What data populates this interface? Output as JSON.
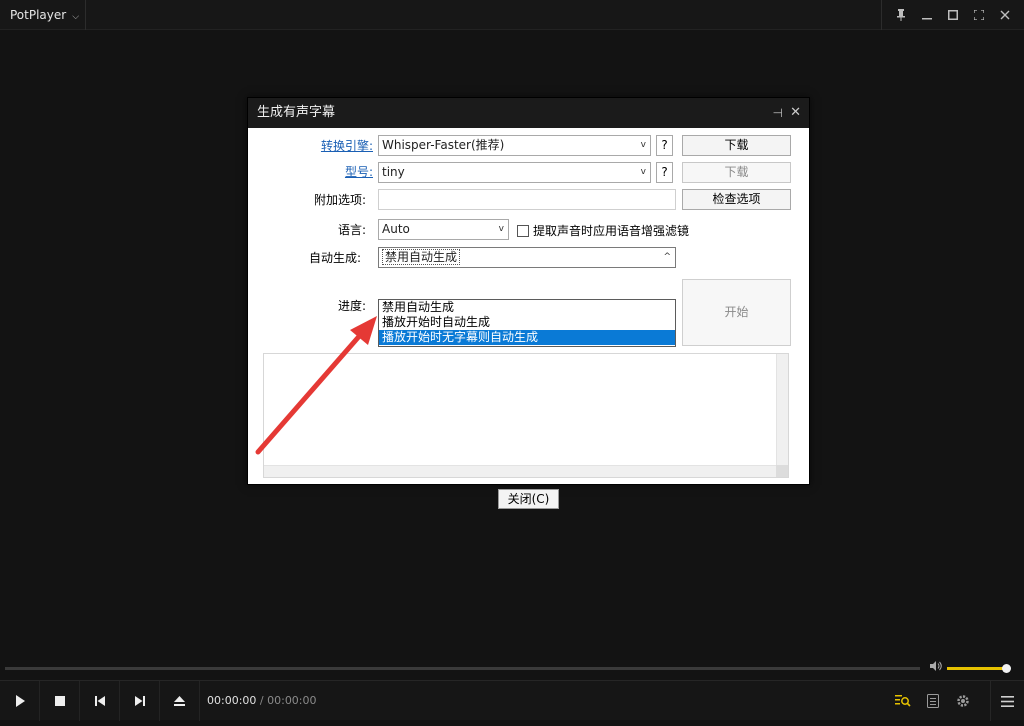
{
  "app": {
    "menu_label": "PotPlayer",
    "menu_chevron": "⌵"
  },
  "window_controls": {
    "pin": "📌",
    "minimize": "—",
    "maximize": "▭",
    "fullscreen": "⤢",
    "close": "✕"
  },
  "dialog": {
    "title": "生成有声字幕",
    "pin_icon": "⊣",
    "close_icon": "✕",
    "engine_label": "转换引擎:",
    "engine_value": "Whisper-Faster(推荐)",
    "engine_help": "?",
    "download_btn": "下载",
    "model_label": "型号:",
    "model_value": "tiny",
    "model_help": "?",
    "download_btn2": "下载",
    "extra_label": "附加选项:",
    "extra_value": "",
    "check_btn": "检查选项",
    "language_label": "语言:",
    "language_value": "Auto",
    "voice_filter_label": "提取声音时应用语音增强滤镜",
    "auto_label": "自动生成:",
    "auto_value": "禁用自动生成",
    "auto_options": [
      "禁用自动生成",
      "播放开始时自动生成",
      "播放开始时无字幕则自动生成"
    ],
    "auto_selected_index": 2,
    "progress_label": "进度:",
    "start_btn": "开始",
    "close_btn": "关闭(C)"
  },
  "player": {
    "time_current": "00:00:00",
    "time_sep": " / ",
    "time_total": "00:00:00",
    "volume_level": 0.95
  },
  "colors": {
    "accent": "#e6c200",
    "selection": "#0a7ad6",
    "arrow": "#e53935"
  }
}
